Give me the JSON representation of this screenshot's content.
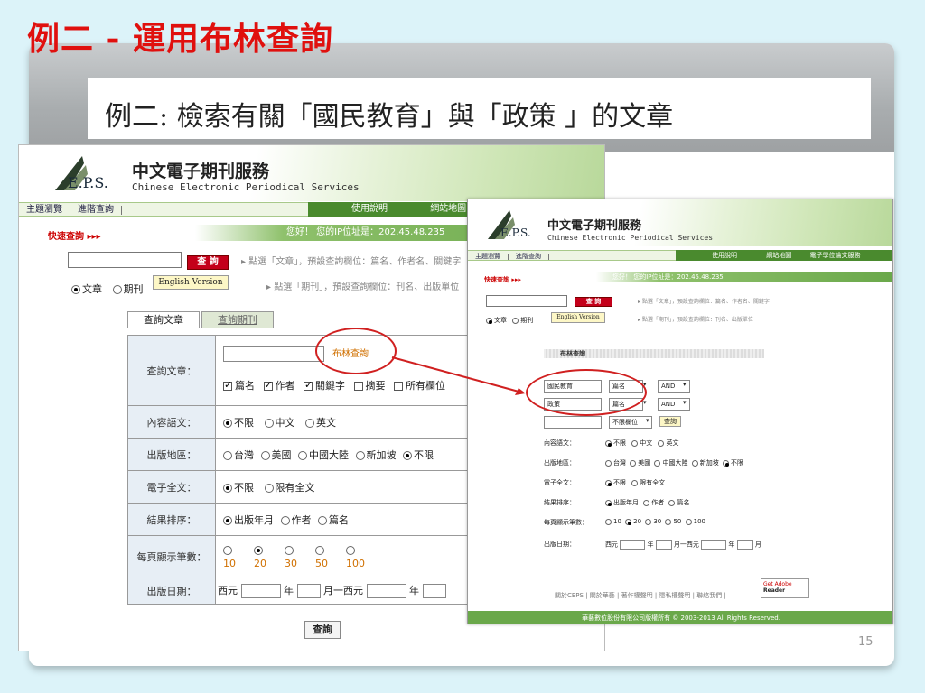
{
  "slide": {
    "title": "例二 - 運用布林查詢",
    "subtitle": "例二: 檢索有關「國民教育」與「政策 」的文章",
    "page_number": "15"
  },
  "site": {
    "brand_cn": "中文電子期刊服務",
    "brand_en": "Chinese Electronic Periodical Services",
    "logo_text": "E.P.S.",
    "nav": [
      "主題瀏覽",
      "進階查詢"
    ],
    "nav_right": [
      "使用說明",
      "網站地圖",
      "電子學位論文服務"
    ],
    "greeting": "您好！ 您的IP位址是：202.45.48.235",
    "quick_search": "快速查詢 ▸▸▸",
    "search_button": "查 詢",
    "english_button": "English Version",
    "radio_article": "文章",
    "radio_journal": "期刊",
    "hint_article": "▸ 點選「文章」，預設查詢欄位：篇名、作者名、關鍵字",
    "hint_journal": "▸ 點選「期刊」，預設查詢欄位：刊名、出版單位"
  },
  "form": {
    "tab_article": "查詢文章",
    "tab_journal": "查詢期刊",
    "boolean_link": "布林查詢",
    "rows": {
      "query": {
        "label": "查詢文章：",
        "checks": [
          "篇名",
          "作者",
          "關鍵字",
          "摘要",
          "所有欄位"
        ]
      },
      "language": {
        "label": "內容語文：",
        "options": [
          "不限",
          "中文",
          "英文"
        ]
      },
      "region": {
        "label": "出版地區：",
        "options": [
          "台灣",
          "美國",
          "中國大陸",
          "新加坡",
          "不限"
        ]
      },
      "fulltext": {
        "label": "電子全文：",
        "options": [
          "不限",
          "限有全文"
        ]
      },
      "sort": {
        "label": "結果排序：",
        "options": [
          "出版年月",
          "作者",
          "篇名"
        ]
      },
      "per_page": {
        "label": "每頁顯示筆數：",
        "options": [
          "10",
          "20",
          "30",
          "50",
          "100"
        ]
      },
      "date": {
        "label": "出版日期：",
        "west": "西元",
        "year": "年",
        "month_to": "月一西元"
      }
    },
    "submit": "查詢"
  },
  "boolean_panel": {
    "header": "布林查詢",
    "row1_value": "國民教育",
    "row2_value": "政策",
    "field_select": "篇名",
    "op_select": "AND",
    "all_fields": "不限欄位",
    "search_btn": "查詢",
    "year": "年",
    "month": "月",
    "date_range": "月一西元",
    "footer_links": "關於CEPS | 關於華藝 | 著作權聲明 | 隱私權聲明 | 聯絡我們 |",
    "copyright": "華藝數位股份有限公司版權所有 © 2003-2013 All Rights Reserved.",
    "adobe_get": "Get Adobe",
    "adobe_reader": "Reader"
  }
}
